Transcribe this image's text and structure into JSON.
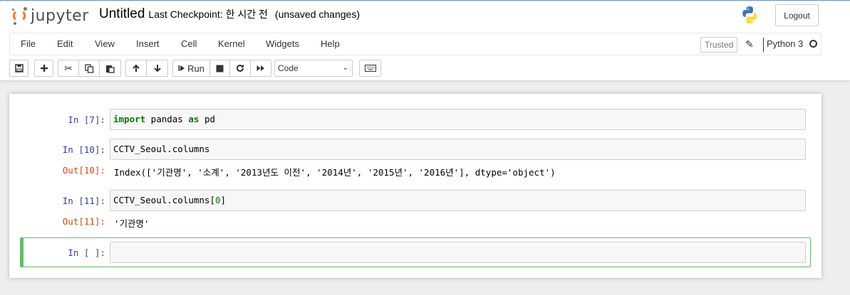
{
  "header": {
    "logo_text": "jupyter",
    "notebook_name": "Untitled",
    "checkpoint": "Last Checkpoint: 한 시간 전",
    "unsaved": "(unsaved changes)",
    "logout_label": "Logout"
  },
  "menubar": {
    "items": [
      "File",
      "Edit",
      "View",
      "Insert",
      "Cell",
      "Kernel",
      "Widgets",
      "Help"
    ],
    "trusted_label": "Trusted",
    "kernel_name": "Python 3"
  },
  "toolbar": {
    "run_label": "Run",
    "cell_type": "Code"
  },
  "cells": [
    {
      "in_prompt": "In [7]:",
      "code_parts": [
        [
          "kw",
          "import"
        ],
        [
          "txt",
          " pandas "
        ],
        [
          "kw",
          "as"
        ],
        [
          "txt",
          " pd"
        ]
      ]
    },
    {
      "in_prompt": "In [10]:",
      "code": "CCTV_Seoul.columns",
      "out_prompt": "Out[10]:",
      "output": "Index(['기관명', '소계', '2013년도 이전', '2014년', '2015년', '2016년'], dtype='object')"
    },
    {
      "in_prompt": "In [11]:",
      "code_parts": [
        [
          "txt",
          "CCTV_Seoul.columns["
        ],
        [
          "num",
          "0"
        ],
        [
          "txt",
          "]"
        ]
      ],
      "out_prompt": "Out[11]:",
      "output": "'기관명'"
    },
    {
      "in_prompt": "In [ ]:",
      "code": ""
    }
  ],
  "colors": {
    "logo_orange": "#f37726",
    "in_prompt": "#303f9f",
    "out_prompt": "#d84315",
    "selected_border": "#66bb6a",
    "keyword": "#008000"
  }
}
